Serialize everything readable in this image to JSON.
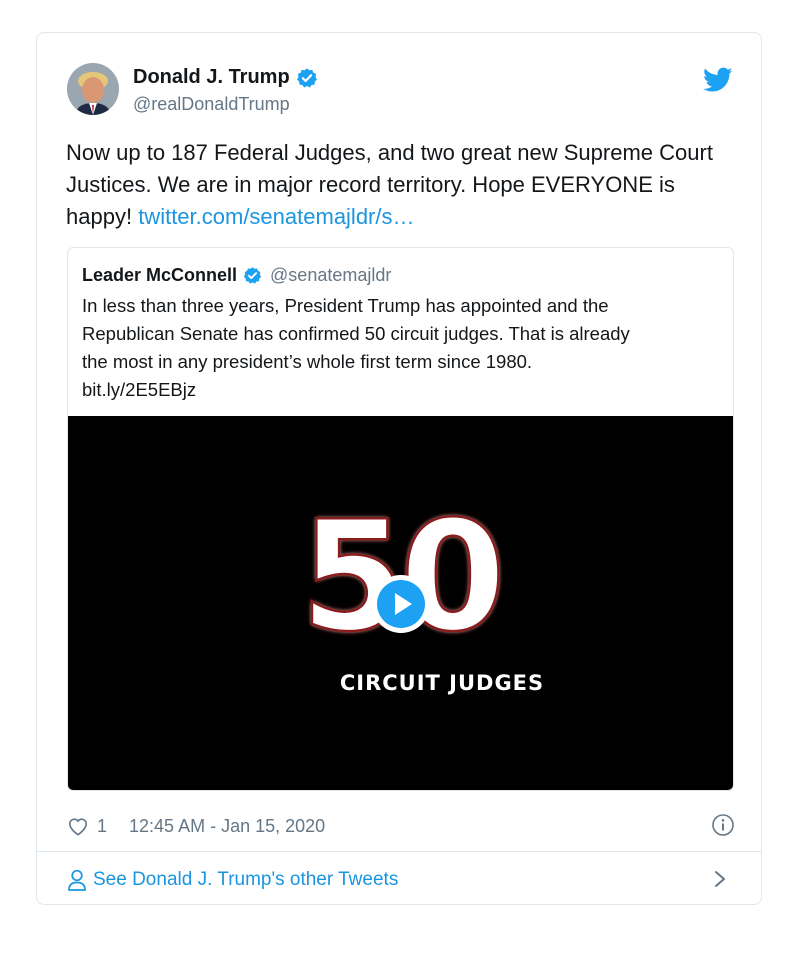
{
  "tweet": {
    "author": {
      "name": "Donald J. Trump",
      "handle": "@realDonaldTrump",
      "avatar_icon": "portrait-avatar"
    },
    "text": "Now up to 187 Federal Judges, and two great new Supreme Court Justices. We are in major record territory. Hope EVERYONE is happy!",
    "link_text": "twitter.com/senatemajldr/s…",
    "likes": "1",
    "timestamp": "12:45 AM - Jan 15, 2020"
  },
  "quoted": {
    "name": "Leader McConnell",
    "handle": "@senatemajldr",
    "text_lines": [
      "In less than three years, President Trump has appointed and the",
      "Republican Senate has confirmed 50 circuit judges. That is already",
      "the most in any president’s whole first term since 1980.",
      "bit.ly/2E5EBjz"
    ],
    "media": {
      "big_number": "50",
      "caption": "CIRCUIT JUDGES",
      "type": "video"
    }
  },
  "footer": {
    "other_tweets_label": "See Donald J. Trump's other Tweets"
  },
  "colors": {
    "link": "#1b95e0",
    "verified": "#1da1f2",
    "muted": "#657786",
    "border": "#e1e8ed"
  },
  "icons": [
    "twitter-bird-icon",
    "verified-badge-icon",
    "heart-icon",
    "info-icon",
    "person-icon",
    "chevron-right-icon",
    "play-icon"
  ]
}
